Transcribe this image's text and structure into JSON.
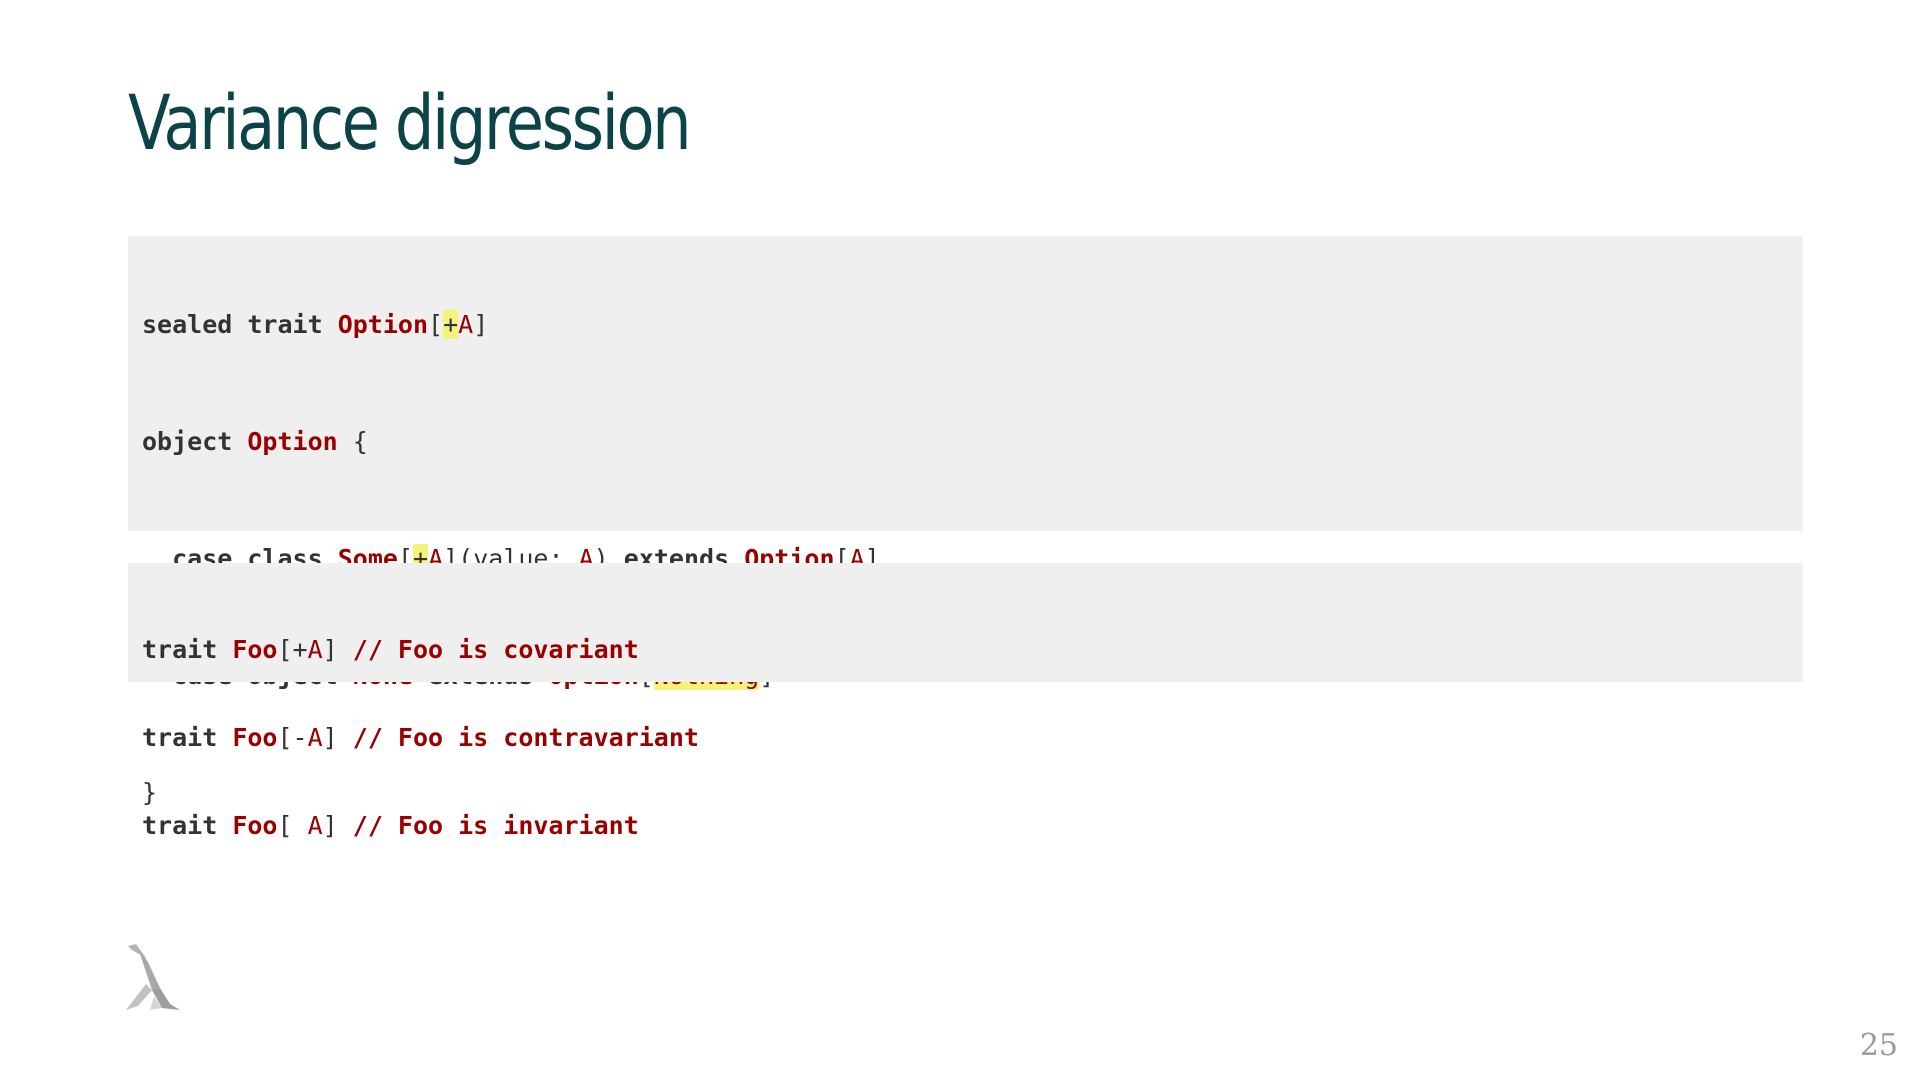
{
  "slide": {
    "title": "Variance digression",
    "page_number": "25",
    "logo": "lambda-logo"
  },
  "code_block_1": {
    "lines": [
      [
        {
          "t": "sealed",
          "c": "kw"
        },
        {
          "t": " ",
          "c": "pl"
        },
        {
          "t": "trait",
          "c": "kw"
        },
        {
          "t": " ",
          "c": "pl"
        },
        {
          "t": "Option",
          "c": "ty"
        },
        {
          "t": "[",
          "c": "pl"
        },
        {
          "t": "+",
          "c": "pl",
          "hl": true
        },
        {
          "t": "A",
          "c": "tp"
        },
        {
          "t": "]",
          "c": "pl"
        }
      ],
      [
        {
          "t": "object",
          "c": "kw"
        },
        {
          "t": " ",
          "c": "pl"
        },
        {
          "t": "Option",
          "c": "ty"
        },
        {
          "t": " {",
          "c": "pl"
        }
      ],
      [
        {
          "t": "  ",
          "c": "pl"
        },
        {
          "t": "case",
          "c": "kw"
        },
        {
          "t": " ",
          "c": "pl"
        },
        {
          "t": "class",
          "c": "kw"
        },
        {
          "t": " ",
          "c": "pl"
        },
        {
          "t": "Some",
          "c": "ty"
        },
        {
          "t": "[",
          "c": "pl"
        },
        {
          "t": "+",
          "c": "pl",
          "hl": true
        },
        {
          "t": "A",
          "c": "tp"
        },
        {
          "t": "](value: ",
          "c": "pl"
        },
        {
          "t": "A",
          "c": "tp"
        },
        {
          "t": ") ",
          "c": "pl"
        },
        {
          "t": "extends",
          "c": "kw"
        },
        {
          "t": " ",
          "c": "pl"
        },
        {
          "t": "Option",
          "c": "ty"
        },
        {
          "t": "[",
          "c": "pl"
        },
        {
          "t": "A",
          "c": "tp"
        },
        {
          "t": "]",
          "c": "pl"
        }
      ],
      [
        {
          "t": "  ",
          "c": "pl"
        },
        {
          "t": "case",
          "c": "kw"
        },
        {
          "t": " ",
          "c": "pl"
        },
        {
          "t": "object",
          "c": "kw"
        },
        {
          "t": " ",
          "c": "pl"
        },
        {
          "t": "None",
          "c": "ty"
        },
        {
          "t": " ",
          "c": "pl"
        },
        {
          "t": "extends",
          "c": "kw"
        },
        {
          "t": " ",
          "c": "pl"
        },
        {
          "t": "Option",
          "c": "ty"
        },
        {
          "t": "[",
          "c": "pl"
        },
        {
          "t": "Nothing",
          "c": "tp",
          "hl": true
        },
        {
          "t": "]",
          "c": "pl"
        }
      ],
      [
        {
          "t": "}",
          "c": "pl"
        }
      ]
    ]
  },
  "code_block_2": {
    "lines": [
      [
        {
          "t": "trait",
          "c": "kw"
        },
        {
          "t": " ",
          "c": "pl"
        },
        {
          "t": "Foo",
          "c": "ty"
        },
        {
          "t": "[+",
          "c": "pl"
        },
        {
          "t": "A",
          "c": "tp"
        },
        {
          "t": "] ",
          "c": "pl"
        },
        {
          "t": "// Foo is covariant",
          "c": "cm"
        }
      ],
      [
        {
          "t": "trait",
          "c": "kw"
        },
        {
          "t": " ",
          "c": "pl"
        },
        {
          "t": "Foo",
          "c": "ty"
        },
        {
          "t": "[-",
          "c": "pl"
        },
        {
          "t": "A",
          "c": "tp"
        },
        {
          "t": "] ",
          "c": "pl"
        },
        {
          "t": "// Foo is contravariant",
          "c": "cm"
        }
      ],
      [
        {
          "t": "trait",
          "c": "kw"
        },
        {
          "t": " ",
          "c": "pl"
        },
        {
          "t": "Foo",
          "c": "ty"
        },
        {
          "t": "[ ",
          "c": "pl"
        },
        {
          "t": "A",
          "c": "tp"
        },
        {
          "t": "] ",
          "c": "pl"
        },
        {
          "t": "// Foo is invariant",
          "c": "cm"
        }
      ]
    ]
  },
  "colors": {
    "title": "#0b4349",
    "keyword": "#333333",
    "type_name": "#990000",
    "comment": "#990000",
    "highlight": "#f6f37a",
    "code_background": "#efefef",
    "page_number": "#9a9a9a"
  }
}
